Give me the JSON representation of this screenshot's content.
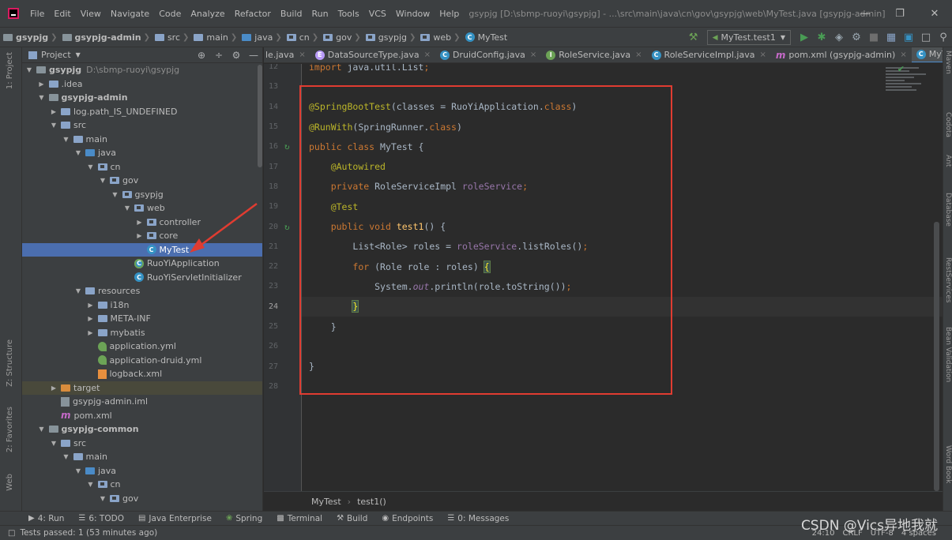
{
  "menubar": {
    "items": [
      "File",
      "Edit",
      "View",
      "Navigate",
      "Code",
      "Analyze",
      "Refactor",
      "Build",
      "Run",
      "Tools",
      "VCS",
      "Window",
      "Help"
    ],
    "title": "gsypjg [D:\\sbmp-ruoyi\\gsypjg] - ...\\src\\main\\java\\cn\\gov\\gsypjg\\web\\MyTest.java [gsypjg-admin]"
  },
  "navbar": {
    "crumbs": [
      "gsypjg",
      "gsypjg-admin",
      "src",
      "main",
      "java",
      "cn",
      "gov",
      "gsypjg",
      "web",
      "MyTest"
    ],
    "run_config": "MyTest.test1"
  },
  "left_stripe": {
    "project_tab": "1: Project",
    "structure_tab": "Z: Structure",
    "favorites_tab": "2: Favorites",
    "web_tab": "Web"
  },
  "right_stripe": {
    "tabs": [
      "Maven",
      "Codota",
      "Ant",
      "Database",
      "RestServices",
      "Bean Validation",
      "Word Book"
    ]
  },
  "project": {
    "header": "Project",
    "tree": [
      {
        "label": "gsypjg",
        "hint": "D:\\sbmp-ruoyi\\gsypjg",
        "indent": 0,
        "arrow": "down",
        "icon": "mod",
        "bold": true
      },
      {
        "label": ".idea",
        "indent": 1,
        "arrow": "right",
        "icon": "folder"
      },
      {
        "label": "gsypjg-admin",
        "indent": 1,
        "arrow": "down",
        "icon": "mod",
        "bold": true
      },
      {
        "label": "log.path_IS_UNDEFINED",
        "indent": 2,
        "arrow": "right",
        "icon": "folder"
      },
      {
        "label": "src",
        "indent": 2,
        "arrow": "down",
        "icon": "folder"
      },
      {
        "label": "main",
        "indent": 3,
        "arrow": "down",
        "icon": "folder"
      },
      {
        "label": "java",
        "indent": 4,
        "arrow": "down",
        "icon": "src"
      },
      {
        "label": "cn",
        "indent": 5,
        "arrow": "down",
        "icon": "pkg"
      },
      {
        "label": "gov",
        "indent": 6,
        "arrow": "down",
        "icon": "pkg"
      },
      {
        "label": "gsypjg",
        "indent": 7,
        "arrow": "down",
        "icon": "pkg"
      },
      {
        "label": "web",
        "indent": 8,
        "arrow": "down",
        "icon": "pkg"
      },
      {
        "label": "controller",
        "indent": 9,
        "arrow": "right",
        "icon": "pkg"
      },
      {
        "label": "core",
        "indent": 9,
        "arrow": "right",
        "icon": "pkg"
      },
      {
        "label": "MyTest",
        "indent": 9,
        "arrow": "none",
        "icon": "class",
        "selected": true
      },
      {
        "label": "RuoYiApplication",
        "indent": 8,
        "arrow": "none",
        "icon": "spring"
      },
      {
        "label": "RuoYiServletInitializer",
        "indent": 8,
        "arrow": "none",
        "icon": "class"
      },
      {
        "label": "resources",
        "indent": 4,
        "arrow": "down",
        "icon": "res"
      },
      {
        "label": "i18n",
        "indent": 5,
        "arrow": "right",
        "icon": "folder"
      },
      {
        "label": "META-INF",
        "indent": 5,
        "arrow": "right",
        "icon": "folder"
      },
      {
        "label": "mybatis",
        "indent": 5,
        "arrow": "right",
        "icon": "folder"
      },
      {
        "label": "application.yml",
        "indent": 5,
        "arrow": "none",
        "icon": "yml"
      },
      {
        "label": "application-druid.yml",
        "indent": 5,
        "arrow": "none",
        "icon": "yml"
      },
      {
        "label": "logback.xml",
        "indent": 5,
        "arrow": "none",
        "icon": "xml"
      },
      {
        "label": "target",
        "indent": 2,
        "arrow": "right",
        "icon": "orange",
        "target": true
      },
      {
        "label": "gsypjg-admin.iml",
        "indent": 2,
        "arrow": "none",
        "icon": "iml"
      },
      {
        "label": "pom.xml",
        "indent": 2,
        "arrow": "none",
        "icon": "m"
      },
      {
        "label": "gsypjg-common",
        "indent": 1,
        "arrow": "down",
        "icon": "mod",
        "bold": true
      },
      {
        "label": "src",
        "indent": 2,
        "arrow": "down",
        "icon": "folder"
      },
      {
        "label": "main",
        "indent": 3,
        "arrow": "down",
        "icon": "folder"
      },
      {
        "label": "java",
        "indent": 4,
        "arrow": "down",
        "icon": "src"
      },
      {
        "label": "cn",
        "indent": 5,
        "arrow": "down",
        "icon": "pkg"
      },
      {
        "label": "gov",
        "indent": 6,
        "arrow": "down",
        "icon": "pkg"
      }
    ]
  },
  "editor_tabs": [
    {
      "label": "le.java",
      "icon": "none"
    },
    {
      "label": "DataSourceType.java",
      "icon": "enum"
    },
    {
      "label": "DruidConfig.java",
      "icon": "class"
    },
    {
      "label": "RoleService.java",
      "icon": "interface"
    },
    {
      "label": "RoleServiceImpl.java",
      "icon": "class"
    },
    {
      "label": "pom.xml (gsypjg-admin)",
      "icon": "m"
    },
    {
      "label": "MyTest.java",
      "icon": "class",
      "active": true
    }
  ],
  "editor": {
    "lines": [
      {
        "num": "12",
        "text": "import java.util.List;"
      },
      {
        "num": "13",
        "text": ""
      },
      {
        "num": "14",
        "text": "@SpringBootTest(classes = RuoYiApplication.class)"
      },
      {
        "num": "15",
        "text": "@RunWith(SpringRunner.class)"
      },
      {
        "num": "16",
        "text": "public class MyTest {"
      },
      {
        "num": "17",
        "text": "    @Autowired"
      },
      {
        "num": "18",
        "text": "    private RoleServiceImpl roleService;"
      },
      {
        "num": "19",
        "text": "    @Test"
      },
      {
        "num": "20",
        "text": "    public void test1() {"
      },
      {
        "num": "21",
        "text": "        List<Role> roles = roleService.listRoles();"
      },
      {
        "num": "22",
        "text": "        for (Role role : roles) {"
      },
      {
        "num": "23",
        "text": "            System.out.println(role.toString());"
      },
      {
        "num": "24",
        "text": "        }"
      },
      {
        "num": "25",
        "text": "    }"
      },
      {
        "num": "26",
        "text": ""
      },
      {
        "num": "27",
        "text": "}"
      },
      {
        "num": "28",
        "text": ""
      }
    ],
    "breadcrumb": [
      "MyTest",
      "test1()"
    ]
  },
  "bottom_bar": {
    "items": [
      "4: Run",
      "6: TODO",
      "Java Enterprise",
      "Spring",
      "Terminal",
      "Build",
      "Endpoints",
      "0: Messages"
    ]
  },
  "status": {
    "message": "Tests passed: 1 (53 minutes ago)",
    "position": "24:10",
    "line_sep": "CRLF",
    "encoding": "UTF-8",
    "indent": "4 spaces"
  },
  "watermark": "CSDN @Vics异地我就",
  "colors": {
    "keyword": "#cc7832",
    "annotation": "#bbb529",
    "field": "#9876aa",
    "method": "#ffc66d",
    "plain": "#a9b7c6",
    "selection": "#4b6eaf",
    "red_box": "#e03c31"
  }
}
